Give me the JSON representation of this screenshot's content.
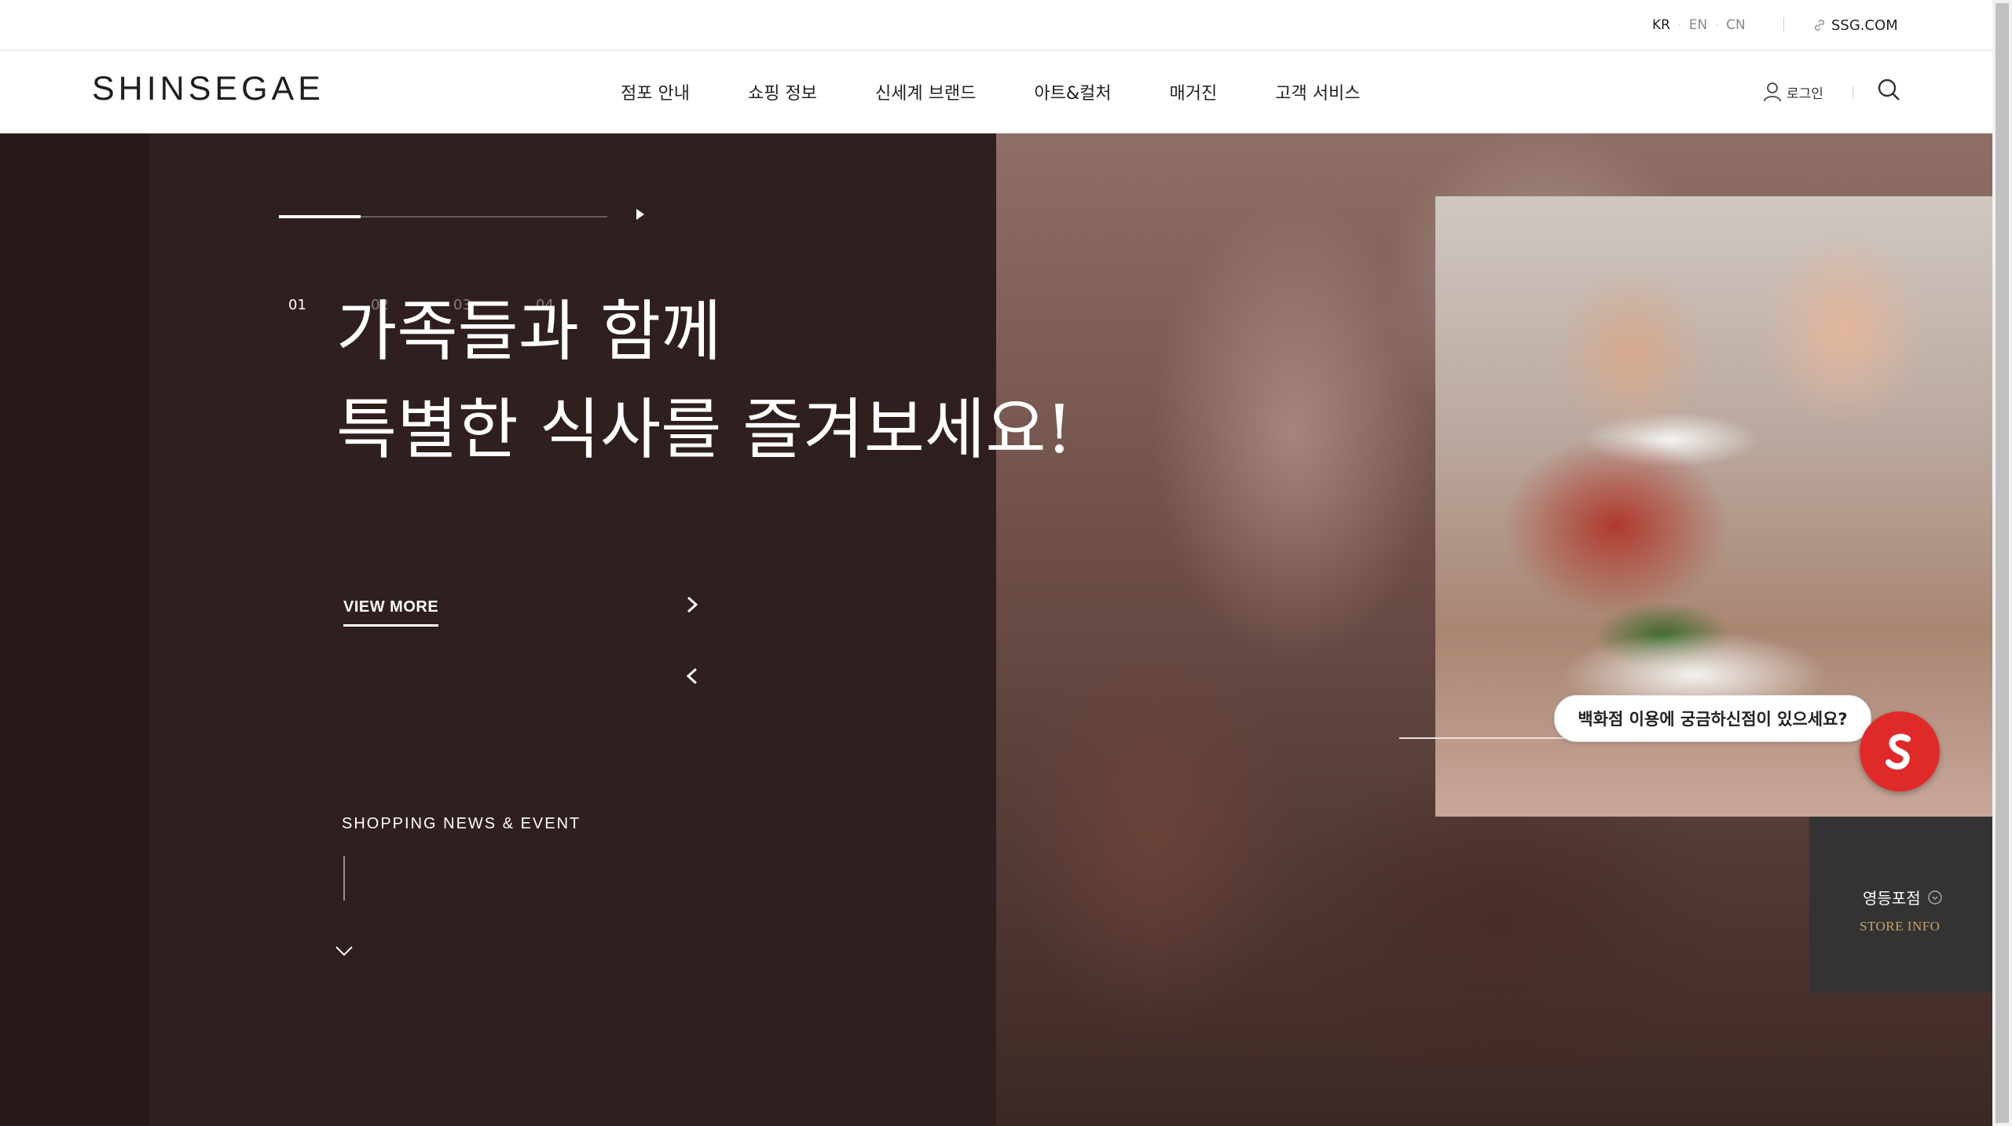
{
  "util_bar": {
    "languages": [
      "KR",
      "EN",
      "CN"
    ],
    "active_language": "KR",
    "ssg_link": "SSG.COM"
  },
  "header": {
    "logo": "SHINSEGAE",
    "nav": [
      "점포 안내",
      "쇼핑 정보",
      "신세계 브랜드",
      "아트&컬처",
      "매거진",
      "고객 서비스"
    ],
    "login": "로그인",
    "icons": {
      "login": "person-icon",
      "search": "search-icon"
    }
  },
  "hero": {
    "pager": [
      "01",
      "02",
      "03",
      "04"
    ],
    "active_page": "01",
    "title_line1": "가족들과 함께",
    "title_line2": "특별한 식사를 즐겨보세요!",
    "view_more": "VIEW MORE",
    "news_label": "SHOPPING NEWS & EVENT"
  },
  "chatbot": {
    "bubble": "백화점 이용에 궁금하신점이 있으세요?",
    "icon": "s-logo-icon",
    "color": "#e02a2a"
  },
  "store_info": {
    "name": "영등포점",
    "sub": "STORE INFO"
  },
  "colors": {
    "hero_panel": "#2f1f1f",
    "accent_gold": "#c9a36a"
  }
}
